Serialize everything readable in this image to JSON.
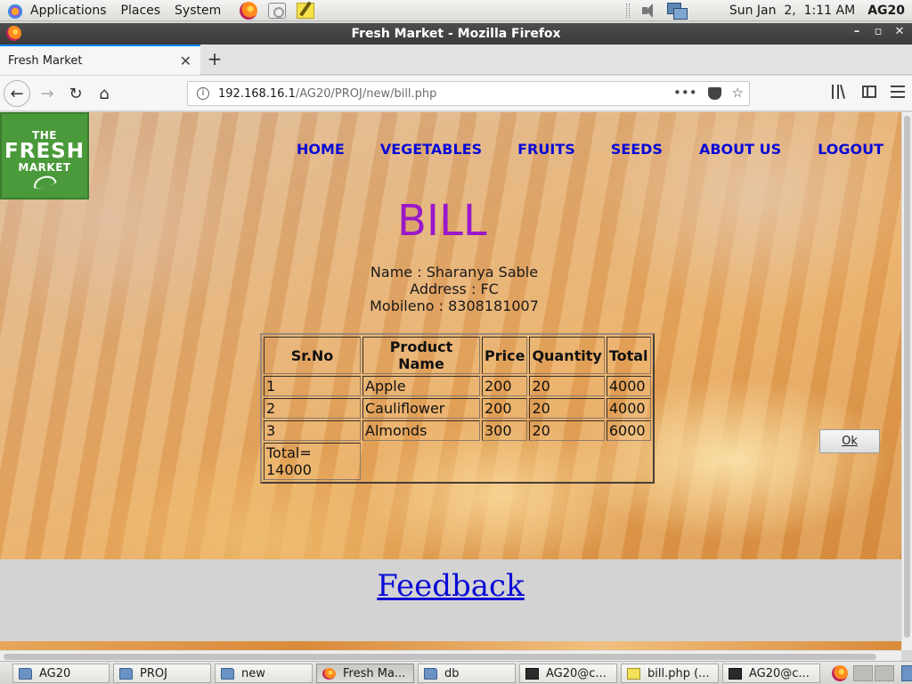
{
  "top_panel": {
    "menus": [
      "Applications",
      "Places",
      "System"
    ],
    "clock": "Sun Jan  2,  1:11 AM",
    "user": "AG20"
  },
  "window": {
    "title": "Fresh Market - Mozilla Firefox"
  },
  "browser": {
    "tab_title": "Fresh Market",
    "url_host": "192.168.16.1",
    "url_path": "/AG20/PROJ/new/bill.php"
  },
  "site": {
    "logo": {
      "line1": "THE",
      "line2": "FRESH",
      "line3": "MARKET"
    },
    "nav": {
      "home": "HOME",
      "vegetables": "VEGETABLES",
      "fruits": "FRUITS",
      "seeds": "SEEDS",
      "about": "ABOUT US",
      "logout": "LOGOUT"
    },
    "title": "BILL",
    "customer": {
      "name": "Name : Sharanya Sable",
      "address": "Address : FC",
      "mobile": "Mobileno : 8308181007"
    },
    "table": {
      "headers": [
        "Sr.No",
        "Product Name",
        "Price",
        "Quantity",
        "Total"
      ],
      "rows": [
        [
          "1",
          "Apple",
          "200",
          "20",
          "4000"
        ],
        [
          "2",
          "Cauliflower",
          "200",
          "20",
          "4000"
        ],
        [
          "3",
          "Almonds",
          "300",
          "20",
          "6000"
        ]
      ],
      "grand_total": "Total= 14000"
    },
    "ok_label": "Ok",
    "feedback_label": "Feedback"
  },
  "taskbar": {
    "items": [
      "AG20",
      "PROJ",
      "new",
      "Fresh Ma...",
      "db",
      "AG20@c...",
      "bill.php (...",
      "AG20@c..."
    ]
  },
  "colors": {
    "bill_title": "#9a18c9",
    "nav_link": "#0a0ad6",
    "logo_green": "#4a9a3b",
    "tab_accent": "#0a84ff"
  }
}
